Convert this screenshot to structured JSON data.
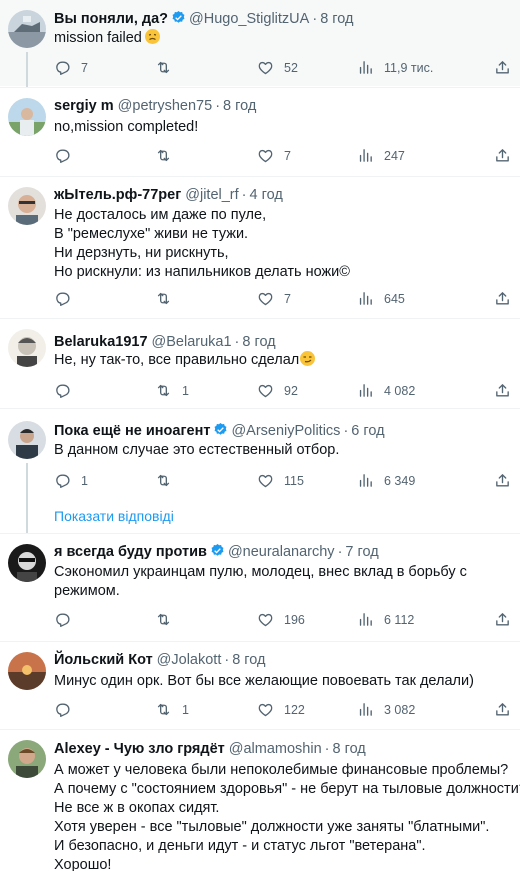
{
  "colors": {
    "accent": "#1d9bf0",
    "muted": "#536471",
    "like": "#f91880",
    "text": "#0f1419"
  },
  "show_replies_label": "Показати відповіді",
  "tweets": [
    {
      "name": "Вы поняли, да?",
      "verified": true,
      "handle": "@Hugo_StiglitzUA",
      "time": "8 год",
      "lines": [
        "mission failed"
      ],
      "emoji": "face-icon",
      "replies": "7",
      "retweets": "",
      "likes": "52",
      "views": "11,9 тис."
    },
    {
      "name": "sergiy m",
      "verified": false,
      "handle": "@petryshen75",
      "time": "8 год",
      "lines": [
        "no,mission completed!"
      ],
      "replies": "",
      "retweets": "",
      "likes": "7",
      "views": "247"
    },
    {
      "name": "жЫтель.рф-77рег",
      "verified": false,
      "handle": "@jitel_rf",
      "time": "4 год",
      "lines": [
        "Не досталось им даже по пуле,",
        "В \"ремеслухе\" живи не тужи.",
        "Ни дерзнуть, ни рискнуть,",
        "Но рискнули: из напильников делать ножи©"
      ],
      "replies": "",
      "retweets": "",
      "likes": "7",
      "views": "645"
    },
    {
      "name": "Belaruka1917",
      "verified": false,
      "handle": "@Belaruka1",
      "time": "8 год",
      "lines": [
        "Не, ну так-то, все правильно сделал"
      ],
      "emoji": "smirk-icon",
      "replies": "",
      "retweets": "1",
      "likes": "92",
      "views": "4 082"
    },
    {
      "name": "Пока ещё не иноагент",
      "verified": true,
      "handle": "@ArseniyPolitics",
      "time": "6 год",
      "lines": [
        "В данном случае это естественный отбор."
      ],
      "replies": "1",
      "retweets": "",
      "likes": "115",
      "views": "6 349"
    },
    {
      "name": "я всегда буду против",
      "verified": true,
      "handle": "@neuralanarchy",
      "time": "7 год",
      "lines": [
        "Сэкономил украинцам пулю, молодец,  внес вклад в борьбу с",
        "режимом."
      ],
      "replies": "",
      "retweets": "",
      "likes": "196",
      "views": "6 112"
    },
    {
      "name": "Йольский Кот",
      "verified": false,
      "handle": "@Jolakott",
      "time": "8 год",
      "lines": [
        "Минус один орк. Вот бы все желающие повоевать так делали)"
      ],
      "replies": "",
      "retweets": "1",
      "likes": "122",
      "views": "3 082"
    },
    {
      "name": "Alexey - Чую зло грядёт",
      "verified": false,
      "handle": "@almamoshin",
      "time": "8 год",
      "lines": [
        "А может у человека были непоколебимые финансовые проблемы?",
        "А почему с \"состоянием здоровья\" - не берут на тыловые должности?",
        "Не все ж в окопах сидят.",
        "Хотя уверен - все \"тыловые\" должности уже заняты \"блатными\".",
        "И безопасно, и деньги идут - и статус льгот \"ветерана\".",
        "Хорошо!"
      ],
      "replies": "",
      "retweets": "",
      "likes": "",
      "views": ""
    }
  ]
}
